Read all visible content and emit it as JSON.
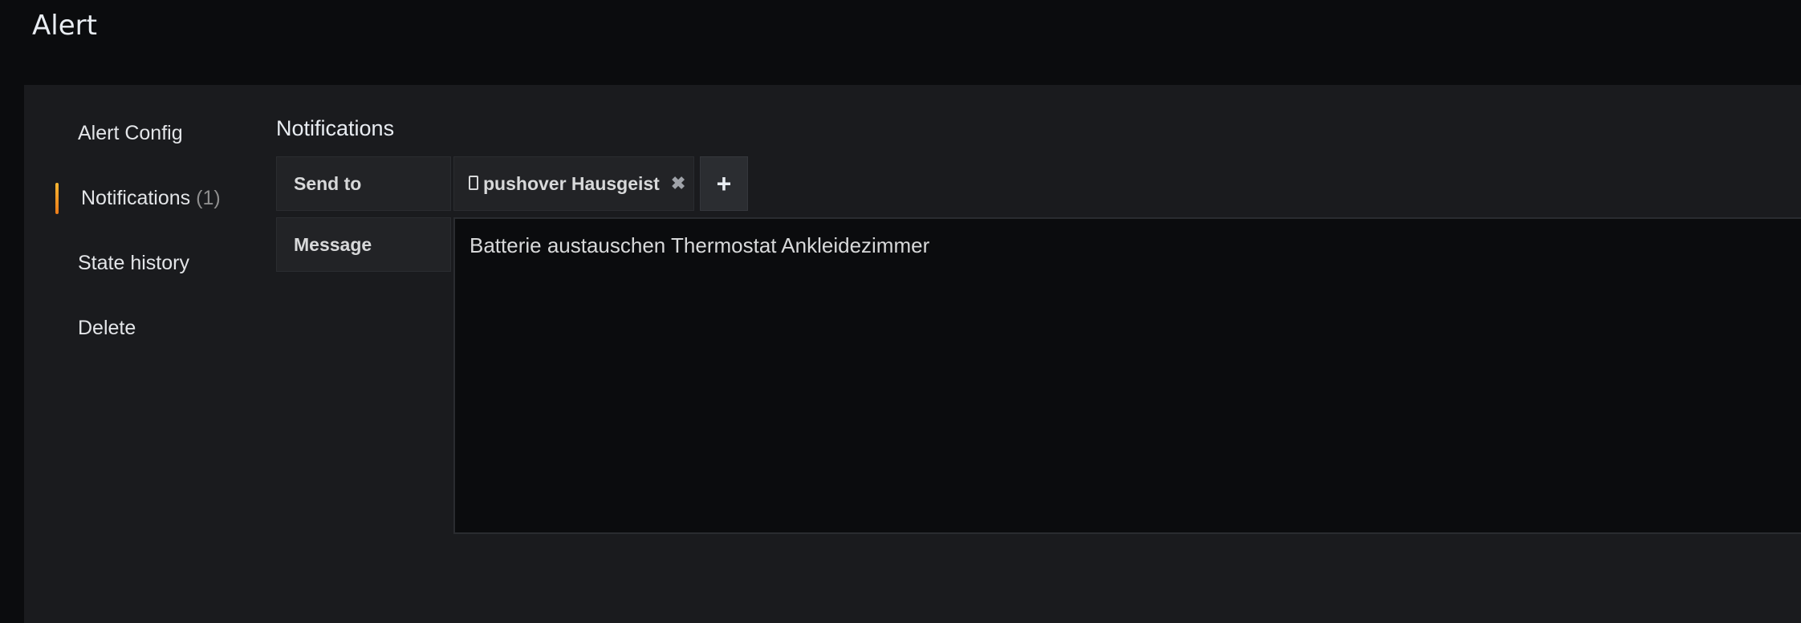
{
  "header": {
    "title": "Alert"
  },
  "sidenav": {
    "items": [
      {
        "label": "Alert Config"
      },
      {
        "label": "Notifications",
        "count": "(1)",
        "active": true
      },
      {
        "label": "State history"
      },
      {
        "label": "Delete"
      }
    ],
    "active_accent": "#f7b733"
  },
  "notifications": {
    "section_title": "Notifications",
    "send_to": {
      "label": "Send to",
      "chips": [
        {
          "icon": "mobile-phone-icon",
          "label": "pushover Hausgeist",
          "remove_icon": "close-icon"
        }
      ],
      "add_icon": "plus-icon"
    },
    "message": {
      "label": "Message",
      "value": "Batterie austauschen Thermostat Ankleidezimmer"
    }
  }
}
